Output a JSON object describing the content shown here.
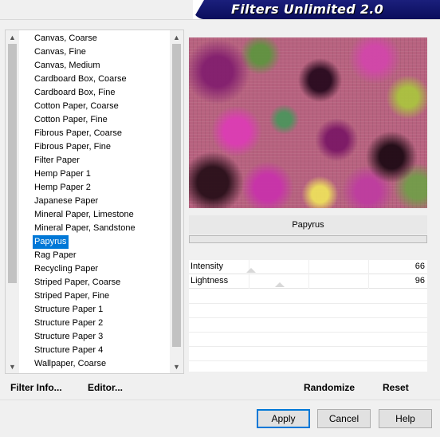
{
  "window": {
    "title": "Filters Unlimited 2.0"
  },
  "filter_list": {
    "items": [
      "Canvas, Coarse",
      "Canvas, Fine",
      "Canvas, Medium",
      "Cardboard Box, Coarse",
      "Cardboard Box, Fine",
      "Cotton Paper, Coarse",
      "Cotton Paper, Fine",
      "Fibrous Paper, Coarse",
      "Fibrous Paper, Fine",
      "Filter Paper",
      "Hemp Paper 1",
      "Hemp Paper 2",
      "Japanese Paper",
      "Mineral Paper, Limestone",
      "Mineral Paper, Sandstone",
      "Papyrus",
      "Rag Paper",
      "Recycling Paper",
      "Striped Paper, Coarse",
      "Striped Paper, Fine",
      "Structure Paper 1",
      "Structure Paper 2",
      "Structure Paper 3",
      "Structure Paper 4",
      "Wallpaper, Coarse"
    ],
    "selected": "Papyrus"
  },
  "left_links": {
    "filter_info": "Filter Info...",
    "editor": "Editor..."
  },
  "filter": {
    "name": "Papyrus",
    "params": [
      {
        "label": "Intensity",
        "value": "66",
        "fraction": 0.26
      },
      {
        "label": "Lightness",
        "value": "96",
        "fraction": 0.38
      }
    ]
  },
  "actions": {
    "randomize": "Randomize",
    "reset": "Reset"
  },
  "footer": {
    "apply": "Apply",
    "cancel": "Cancel",
    "help": "Help"
  },
  "colors": {
    "accent": "#0078d7",
    "banner": "#0a0d5c"
  }
}
